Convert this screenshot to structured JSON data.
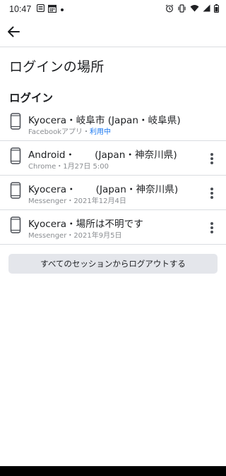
{
  "status_bar": {
    "time": "10:47",
    "left_icons": [
      "photo-icon",
      "calendar-icon",
      "dot-icon"
    ],
    "right_icons": [
      "alarm-icon",
      "vibrate-icon",
      "wifi-icon",
      "signal-icon",
      "battery-icon"
    ]
  },
  "header": {
    "back_icon": "arrow-left-icon"
  },
  "page": {
    "title": "ログインの場所",
    "section_title": "ログイン",
    "logout_all_label": "すべてのセッションからログアウトする"
  },
  "logins": [
    {
      "device": "Kyocera",
      "location": "・岐阜市 (Japan・岐阜県)",
      "app": "Facebookアプリ",
      "separator": "・",
      "status": "利用中",
      "show_more": false
    },
    {
      "device": "Android",
      "location": "・",
      "location_rest": "(Japan・神奈川県)",
      "app": "Chrome",
      "separator": "・",
      "status": "1月27日 5:00",
      "show_more": true
    },
    {
      "device": "Kyocera",
      "location": "・",
      "location_rest": "(Japan・神奈川県)",
      "app": "Messenger",
      "separator": "・",
      "status": "2021年12月4日",
      "show_more": true
    },
    {
      "device": "Kyocera",
      "location": "・場所は不明です",
      "app": "Messenger",
      "separator": "・",
      "status": "2021年9月5日",
      "show_more": true
    }
  ],
  "colors": {
    "accent": "#1877f2",
    "divider": "#dadde1",
    "button_bg": "#e4e6eb",
    "secondary_text": "#8a8d91"
  }
}
